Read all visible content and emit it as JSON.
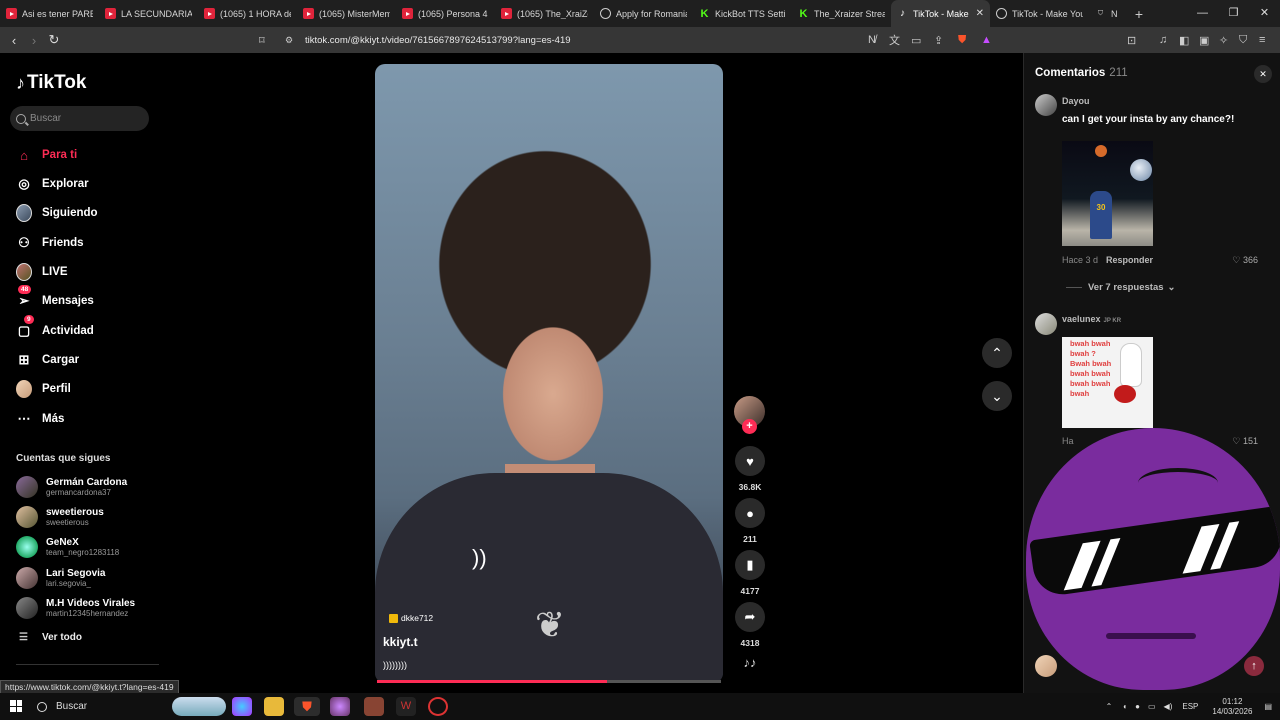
{
  "browser": {
    "tabs": [
      {
        "label": "Asi es tener PARE",
        "icon": "youtube-icon"
      },
      {
        "label": "LA SECUNDARIA E",
        "icon": "youtube-icon"
      },
      {
        "label": "(1065) 1 HORA de",
        "icon": "youtube-icon"
      },
      {
        "label": "(1065) MisterMem",
        "icon": "youtube-icon"
      },
      {
        "label": "(1065) Persona 4 C",
        "icon": "youtube-icon"
      },
      {
        "label": "(1065) The_XraiZe",
        "icon": "youtube-icon"
      },
      {
        "label": "Apply for Romania",
        "icon": "globe-icon"
      },
      {
        "label": "KickBot TTS Settin",
        "icon": "kick-icon"
      },
      {
        "label": "The_Xraizer Stream",
        "icon": "kick-icon"
      },
      {
        "label": "TikTok - Make",
        "icon": "tiktok-icon"
      },
      {
        "label": "TikTok - Make You",
        "icon": "globe-icon"
      },
      {
        "label": "N",
        "icon": "shield-icon"
      }
    ],
    "url": "tiktok.com/@kkiyt.t/video/7615667897624513799?lang=es-419",
    "status_url": "https://www.tiktok.com/@kkiyt.t?lang=es-419"
  },
  "sidebar": {
    "logo": "TikTok",
    "search_placeholder": "Buscar",
    "nav": [
      {
        "label": "Para ti",
        "icon": "home-icon"
      },
      {
        "label": "Explorar",
        "icon": "compass-icon"
      },
      {
        "label": "Siguiendo",
        "icon": "following-avatar-icon"
      },
      {
        "label": "Friends",
        "icon": "friends-icon"
      },
      {
        "label": "LIVE",
        "icon": "live-avatar-icon"
      },
      {
        "label": "Mensajes",
        "icon": "messages-icon",
        "badge": "48"
      },
      {
        "label": "Actividad",
        "icon": "activity-icon",
        "badge": "9"
      },
      {
        "label": "Cargar",
        "icon": "upload-icon"
      },
      {
        "label": "Perfil",
        "icon": "profile-icon"
      },
      {
        "label": "Más",
        "icon": "more-icon"
      }
    ],
    "following_title": "Cuentas que sigues",
    "accounts": [
      {
        "name": "Germán Cardona",
        "handle": "germancardona37"
      },
      {
        "name": "sweetierous",
        "handle": "sweetierous"
      },
      {
        "name": "GeNeX",
        "handle": "team_negro1283118"
      },
      {
        "name": "Lari Segovia",
        "handle": "lari.segovia_"
      },
      {
        "name": "M.H Videos Virales",
        "handle": "martin12345hernandez"
      }
    ],
    "see_all": "Ver todo"
  },
  "video": {
    "badge_user": "dkke712",
    "author": "kkiyt.t",
    "caption": "))))))))",
    "overlay_text": "))",
    "progress": 0.67,
    "likes": "36.8K",
    "comments": "211",
    "saves": "4177",
    "shares": "4318"
  },
  "comments": {
    "title": "Comentarios",
    "count": "211",
    "items": [
      {
        "user": "Dayou",
        "text": "can I get your insta by any chance?!",
        "time": "Hace 3 d",
        "reply": "Responder",
        "likes": "366",
        "replies": "Ver 7 respuestas"
      },
      {
        "user": "vaelunex",
        "tag": "JP KR",
        "time": "Ha",
        "likes": "151",
        "image_text": [
          "bwah bwah",
          "bwah ?",
          "Bwah bwah",
          "bwah bwah",
          "bwah bwah",
          "bwah"
        ]
      }
    ]
  },
  "taskbar": {
    "search": "Buscar",
    "lang": "ESP",
    "time": "01:12",
    "date": "14/03/2026"
  }
}
